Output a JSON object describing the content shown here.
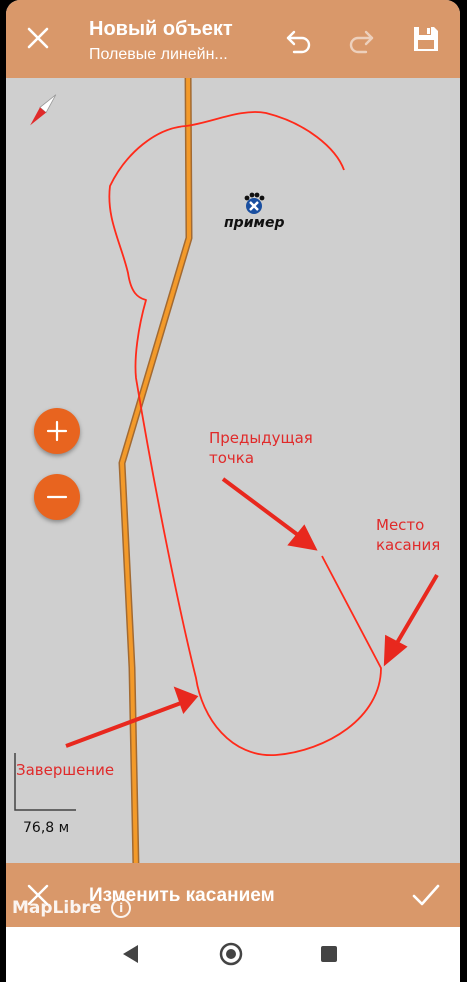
{
  "header": {
    "title": "Новый объект",
    "subtitle": "Полевые линейн...",
    "icons": [
      "close-icon",
      "undo-icon",
      "redo-icon",
      "save-icon"
    ]
  },
  "map": {
    "marker_label": "пример",
    "annotations": {
      "previous_point": [
        "Предыдущая",
        "точка"
      ],
      "touch_point": [
        "Место",
        "касания"
      ],
      "finish": "Завершение"
    },
    "scale": "76,8 м",
    "attribution": "MapLibre",
    "track_color": "#e8641f",
    "path_color": "#ff2a1a"
  },
  "bottom_bar": {
    "label": "Изменить касанием",
    "icons": [
      "close-icon",
      "check-icon"
    ]
  },
  "colors": {
    "bar": "#d9986a",
    "accent": "#e8641f",
    "annotation": "#e02a2a",
    "map_bg": "#cfcfcf"
  }
}
